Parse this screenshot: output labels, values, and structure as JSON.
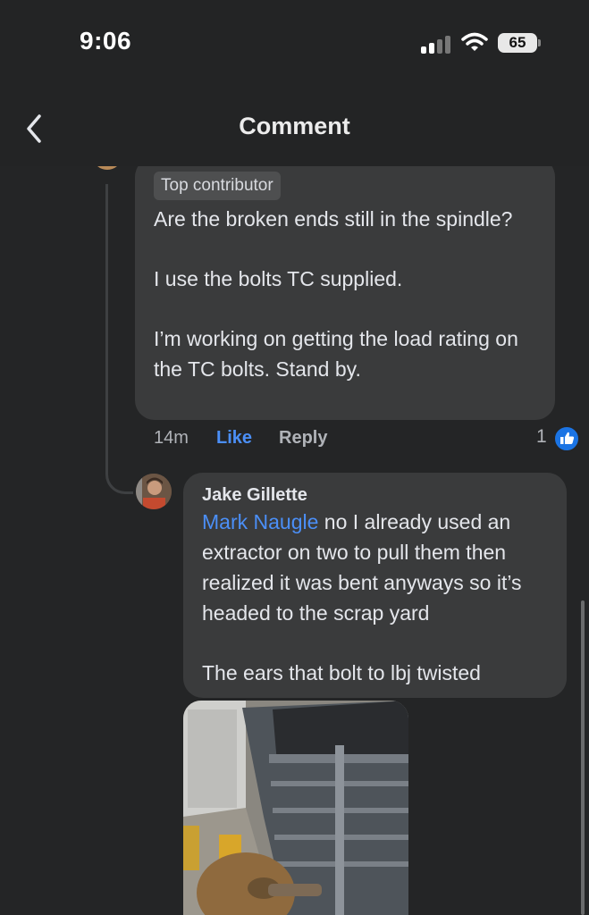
{
  "status_bar": {
    "time": "9:06",
    "battery": "65"
  },
  "header": {
    "title": "Comment"
  },
  "comment1": {
    "badge": "Top contributor",
    "paragraphs": [
      "Are the broken ends still in the spindle?",
      "I use the bolts TC supplied.",
      "I’m working on getting the load rating on the TC bolts.  Stand by."
    ],
    "time": "14m",
    "like_label": "Like",
    "reply_label": "Reply",
    "reaction_count": "1"
  },
  "comment2": {
    "author": "Jake Gillette",
    "mention": "Mark Naugle",
    "paragraph1_rest": " no I already used an extractor on two to pull them then realized it was bent anyways so it’s headed to the scrap yard",
    "paragraph2": "The ears that bolt to lbj twisted"
  },
  "colors": {
    "background": "#242526",
    "bubble": "#3a3b3c",
    "link_blue": "#4b8ff7",
    "like_badge_blue": "#1b74e4"
  }
}
